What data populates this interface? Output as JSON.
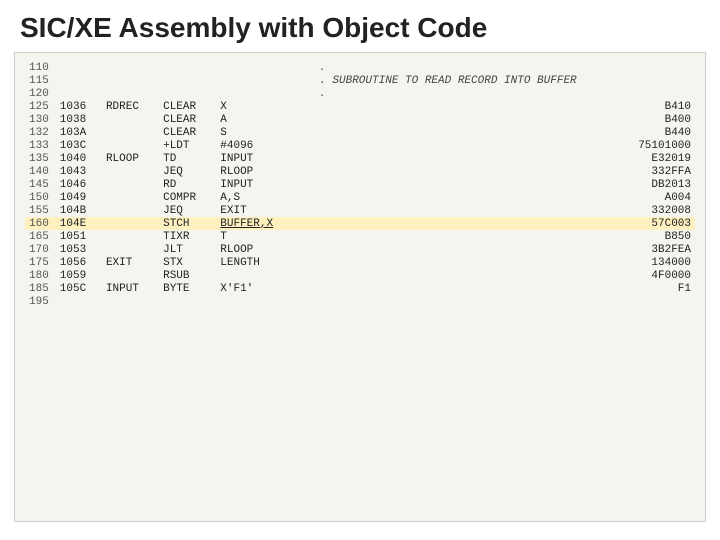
{
  "title": "SIC/XE Assembly with Object Code",
  "rows": [
    {
      "line": "110",
      "addr": "",
      "label": "",
      "op": "",
      "operand": "",
      "comment": ".",
      "objcode": ""
    },
    {
      "line": "115",
      "addr": "",
      "label": "",
      "op": "",
      "operand": "",
      "comment": ". SUBROUTINE TO READ RECORD INTO BUFFER",
      "objcode": ""
    },
    {
      "line": "120",
      "addr": "",
      "label": "",
      "op": "",
      "operand": "",
      "comment": ".",
      "objcode": ""
    },
    {
      "line": "125",
      "addr": "1036",
      "label": "RDREC",
      "op": "CLEAR",
      "operand": "X",
      "comment": "",
      "objcode": "B410"
    },
    {
      "line": "130",
      "addr": "1038",
      "label": "",
      "op": "CLEAR",
      "operand": "A",
      "comment": "",
      "objcode": "B400"
    },
    {
      "line": "132",
      "addr": "103A",
      "label": "",
      "op": "CLEAR",
      "operand": "S",
      "comment": "",
      "objcode": "B440"
    },
    {
      "line": "133",
      "addr": "103C",
      "label": "",
      "op": "+LDT",
      "operand": "#4096",
      "comment": "",
      "objcode": "75101000"
    },
    {
      "line": "135",
      "addr": "1040",
      "label": "RLOOP",
      "op": "TD",
      "operand": "INPUT",
      "comment": "",
      "objcode": "E32019"
    },
    {
      "line": "140",
      "addr": "1043",
      "label": "",
      "op": "JEQ",
      "operand": "RLOOP",
      "comment": "",
      "objcode": "332FFA"
    },
    {
      "line": "145",
      "addr": "1046",
      "label": "",
      "op": "RD",
      "operand": "INPUT",
      "comment": "",
      "objcode": "DB2013"
    },
    {
      "line": "150",
      "addr": "1049",
      "label": "",
      "op": "COMPR",
      "operand": "A,S",
      "comment": "",
      "objcode": "A004"
    },
    {
      "line": "155",
      "addr": "104B",
      "label": "",
      "op": "JEQ",
      "operand": "EXIT",
      "comment": "",
      "objcode": "332008"
    },
    {
      "line": "160",
      "addr": "104E",
      "label": "",
      "op": "STCH",
      "operand": "BUFFER,X",
      "comment": "",
      "objcode": "57C003",
      "highlight": true
    },
    {
      "line": "165",
      "addr": "1051",
      "label": "",
      "op": "TIXR",
      "operand": "T",
      "comment": "",
      "objcode": "B850"
    },
    {
      "line": "170",
      "addr": "1053",
      "label": "",
      "op": "JLT",
      "operand": "RLOOP",
      "comment": "",
      "objcode": "3B2FEA"
    },
    {
      "line": "175",
      "addr": "1056",
      "label": "EXIT",
      "op": "STX",
      "operand": "LENGTH",
      "comment": "",
      "objcode": "134000"
    },
    {
      "line": "180",
      "addr": "1059",
      "label": "",
      "op": "RSUB",
      "operand": "",
      "comment": "",
      "objcode": "4F0000"
    },
    {
      "line": "185",
      "addr": "105C",
      "label": "INPUT",
      "op": "BYTE",
      "operand": "X'F1'",
      "comment": "",
      "objcode": "F1"
    },
    {
      "line": "195",
      "addr": "",
      "label": "",
      "op": "",
      "operand": "",
      "comment": "",
      "objcode": ""
    }
  ]
}
